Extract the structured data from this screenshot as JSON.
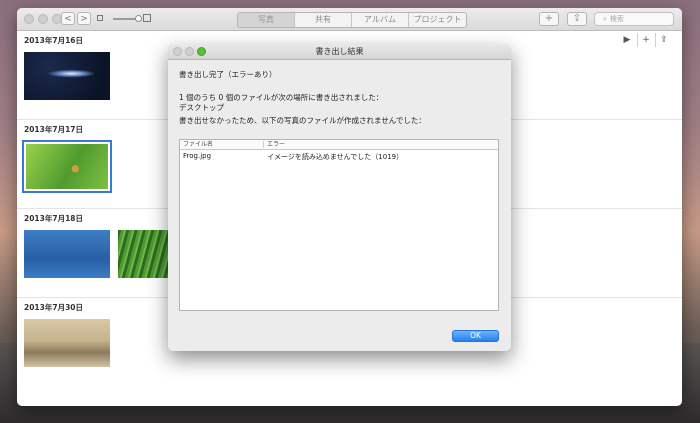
{
  "toolbar": {
    "tabs": [
      "写真",
      "共有",
      "アルバム",
      "プロジェクト"
    ],
    "active_tab_index": 0,
    "add_label": "+",
    "share_label": "⇪",
    "search_placeholder": "検索",
    "back_label": "<",
    "forward_label": ">"
  },
  "content": {
    "controls": {
      "play": "▶",
      "add": "+",
      "share": "⇪"
    },
    "sections": [
      {
        "date": "2013年7月16日",
        "photos": [
          "galaxy"
        ]
      },
      {
        "date": "2013年7月17日",
        "photos": [
          "frog"
        ]
      },
      {
        "date": "2013年7月18日",
        "photos": [
          "water",
          "grass"
        ]
      },
      {
        "date": "2013年7月30日",
        "photos": [
          "fog"
        ]
      }
    ]
  },
  "dialog": {
    "title": "書き出し結果",
    "heading": "書き出し完了（エラーあり）",
    "summary": "1 個のうち 0 個のファイルが次の場所に書き出されました：",
    "location": "デスクトップ",
    "error_intro": "書き出せなかったため、以下の写真のファイルが作成されませんでした：",
    "table": {
      "columns": [
        "ファイル名",
        "エラー"
      ],
      "rows": [
        {
          "filename": "Frog.jpg",
          "error": "イメージを読み込めませんでした（1019）"
        }
      ]
    },
    "ok_label": "OK"
  },
  "colors": {
    "accent": "#2a7ff0",
    "selection": "#3b78d4"
  }
}
